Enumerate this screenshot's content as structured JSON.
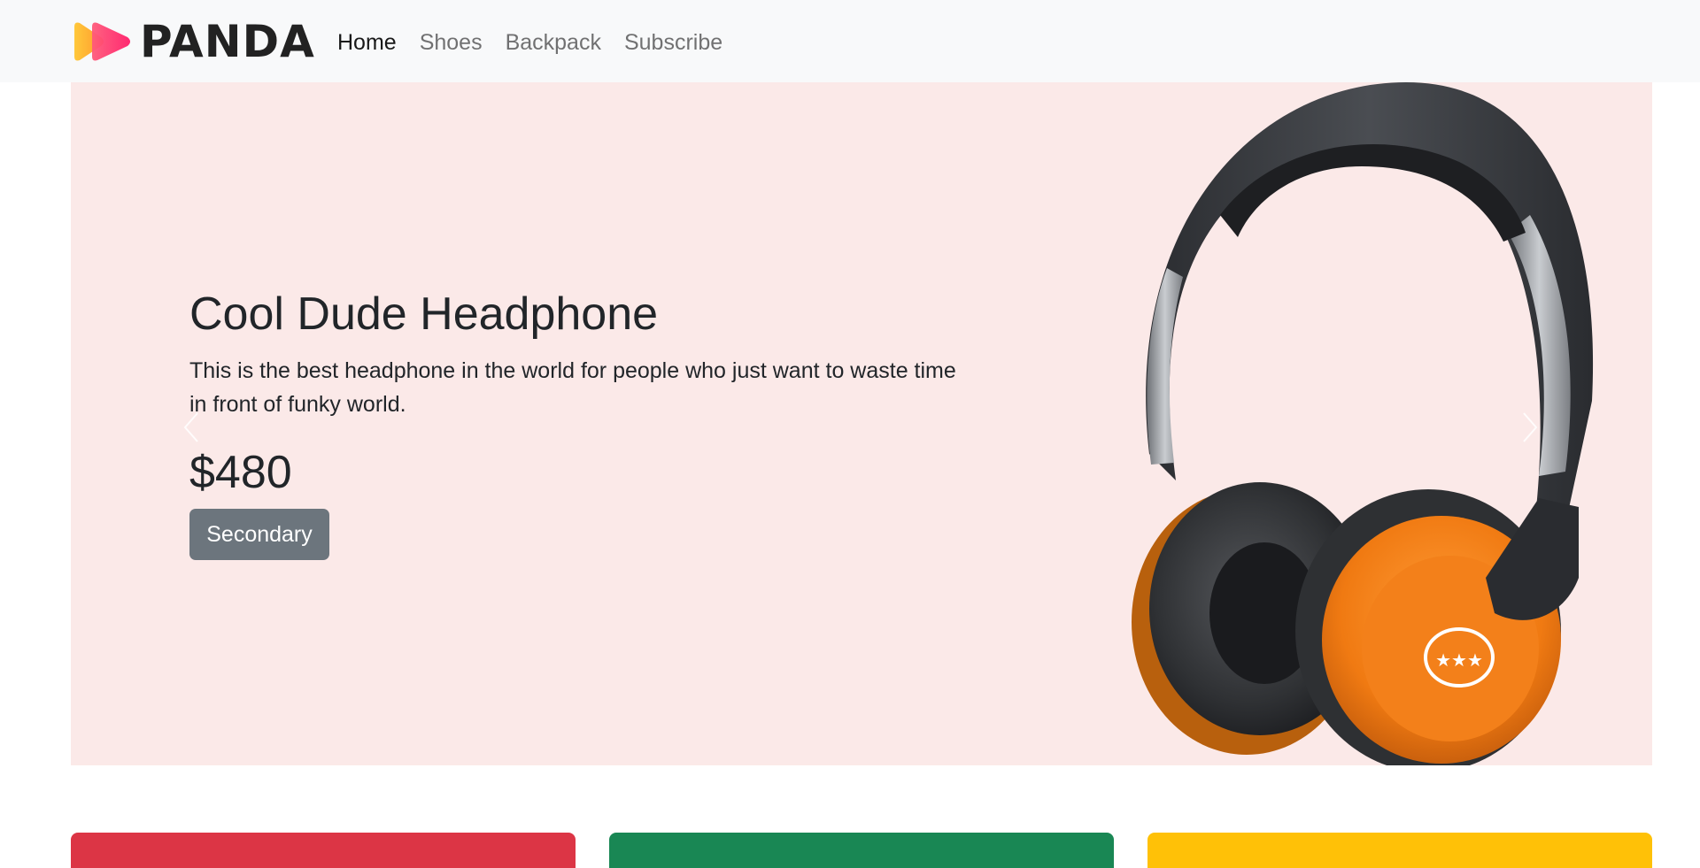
{
  "navbar": {
    "brand": "PANDA",
    "links": [
      {
        "label": "Home",
        "active": true
      },
      {
        "label": "Shoes",
        "active": false
      },
      {
        "label": "Backpack",
        "active": false
      },
      {
        "label": "Subscribe",
        "active": false
      }
    ]
  },
  "hero": {
    "title": "Cool Dude Headphone",
    "description": "This is the best headphone in the world for people who just want to waste time in front of funky world.",
    "price": "$480",
    "button_label": "Secondary",
    "background": "#fbe9e8"
  },
  "cards": [
    {
      "color": "#dc3545"
    },
    {
      "color": "#198754"
    },
    {
      "color": "#ffc107"
    }
  ],
  "icons": [
    "panda-logo-icon",
    "chevron-left-icon",
    "chevron-right-icon"
  ]
}
